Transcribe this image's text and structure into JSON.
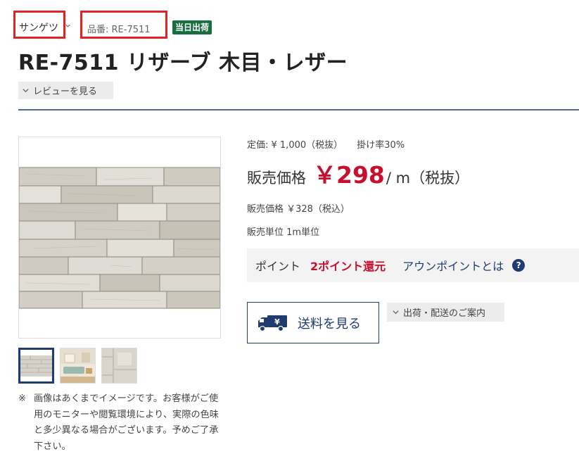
{
  "header": {
    "brand": "サンゲツ",
    "product_code": "品番: RE-7511",
    "badge": "当日出荷"
  },
  "product": {
    "title": "RE-7511 リザーブ 木目・レザー",
    "review_link": "レビューを見る"
  },
  "pricing": {
    "list_price": "定価: ¥ 1,000（税抜）",
    "discount_rate": "掛け率30%",
    "sale_label": "販売価格",
    "sale_price": "￥298",
    "sale_unit": "/ m（税抜）",
    "tax_included": "販売価格 ￥328（税込）",
    "sales_unit": "販売単位 1m単位"
  },
  "points": {
    "label": "ポイント",
    "value": "2ポイント還元",
    "help_text": "アウンポイントとは",
    "help_icon": "?"
  },
  "shipping": {
    "button_label": "送料を見る",
    "delivery_link": "出荷・配送のご案内"
  },
  "gallery": {
    "note_mark": "※",
    "note": "画像はあくまでイメージです。お客様がご使用のモニターや閲覧環境により、実際の色味と多少異なる場合がございます。予めご了承下さい。"
  },
  "icons": {
    "brand_dropdown": "chevron-down-icon",
    "review_toggle": "chevron-down-icon",
    "delivery_toggle": "chevron-down-icon",
    "shipping": "truck-icon",
    "help": "question-circle-icon"
  },
  "colors": {
    "accent_red": "#c8102e",
    "highlight_border": "#e12326",
    "navy": "#1f3b70",
    "badge_green": "#166f3d",
    "divider": "#4a6b96"
  }
}
